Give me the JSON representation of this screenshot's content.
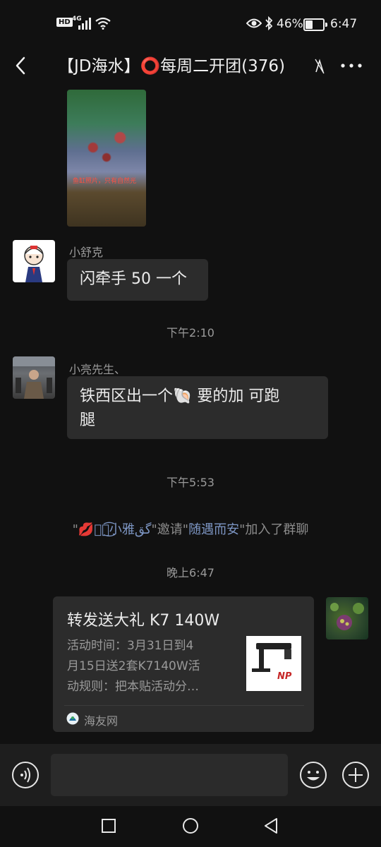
{
  "status_bar": {
    "network_badge": "HD",
    "signal_label": "4G",
    "battery_percent": "46%",
    "battery_level": 0.46,
    "time": "6:47"
  },
  "header": {
    "title": "【JD海水】⭕每周二开团(376)",
    "back_icon": "back-arrow-icon",
    "more_icon": "more-dots-icon"
  },
  "messages": [
    {
      "type": "image",
      "side": "left",
      "image_text": "鱼缸照片，只有自然光"
    },
    {
      "type": "text",
      "side": "left",
      "sender": "小舒克",
      "text": "闪牵手 50 一个"
    },
    {
      "type": "time",
      "text": "下午2:10"
    },
    {
      "type": "text",
      "side": "left",
      "sender": "小亮先生、",
      "text_line1": "铁西区出一个🐚 要的加 可跑",
      "text_line2": "腿"
    },
    {
      "type": "time",
      "text": "下午5:53"
    },
    {
      "type": "system",
      "q1": "\"",
      "inviter": "💋ঔৣ͜͡小雅گق",
      "q2": "\"",
      "verb": "邀请",
      "q3": "\"",
      "invitee": "随遇而安",
      "q4": "\"",
      "suffix": "加入了群聊"
    },
    {
      "type": "time",
      "text": "晚上6:47"
    },
    {
      "type": "link_card",
      "side": "right",
      "title": "转发送大礼 K7 140W",
      "desc_lines": [
        "活动时间：3月31日到4",
        "月15日送2套K7140W活",
        "动规则：把本贴活动分…"
      ],
      "source": "海友网",
      "thumb_text": "NP"
    }
  ],
  "input_bar": {
    "voice_icon": "voice-icon",
    "emoji_icon": "emoji-icon",
    "plus_icon": "plus-icon",
    "input_value": ""
  },
  "nav_bar": {
    "recent_icon": "square-icon",
    "home_icon": "circle-icon",
    "back_icon": "triangle-back-icon"
  },
  "colors": {
    "background": "#111111",
    "bubble": "#2c2c2c",
    "link_text": "#7d96c4"
  }
}
